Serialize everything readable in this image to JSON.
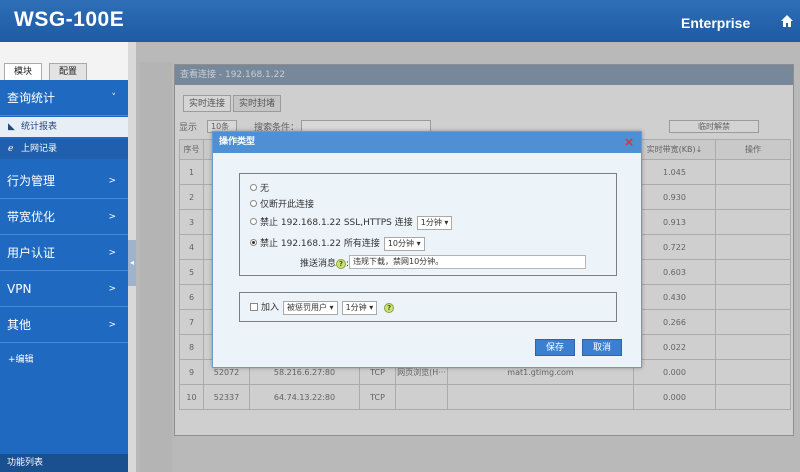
{
  "header": {
    "brand": "WSG-100E",
    "edition": "Enterprise",
    "home_icon": "home-icon"
  },
  "sidebar": {
    "tabs": [
      "模块",
      "配置"
    ],
    "menu": [
      {
        "label": "查询统计",
        "chev": "˅"
      },
      {
        "label": "行为管理",
        "chev": ">"
      },
      {
        "label": "带宽优化",
        "chev": ">"
      },
      {
        "label": "用户认证",
        "chev": ">"
      },
      {
        "label": "VPN",
        "chev": ">"
      },
      {
        "label": "其他",
        "chev": ">"
      }
    ],
    "sub_items": [
      {
        "label": "统计报表",
        "icon": "chart-icon"
      },
      {
        "label": "上网记录",
        "icon": "ie-icon"
      }
    ],
    "edit_link": "+编辑",
    "footer": "功能列表"
  },
  "bg_dialog": {
    "title": "查看连接 - 192.168.1.22",
    "tabs": [
      "实时连接",
      "实时封堵"
    ],
    "show_label": "显示",
    "page_size": "10条",
    "search_label": "搜索条件：",
    "action_button": "临时解禁",
    "columns": [
      "序号",
      "",
      "",
      "",
      "",
      "",
      "实时带宽(KB)↓",
      "操作"
    ],
    "rows": [
      {
        "no": "1",
        "port": "",
        "addr": "",
        "proto": "",
        "app": "",
        "host": "",
        "bw": "1.045"
      },
      {
        "no": "2",
        "port": "",
        "addr": "",
        "proto": "",
        "app": "",
        "host": "",
        "bw": "0.930"
      },
      {
        "no": "3",
        "port": "",
        "addr": "",
        "proto": "",
        "app": "",
        "host": "",
        "bw": "0.913"
      },
      {
        "no": "4",
        "port": "",
        "addr": "",
        "proto": "",
        "app": "",
        "host": "",
        "bw": "0.722"
      },
      {
        "no": "5",
        "port": "",
        "addr": "",
        "proto": "",
        "app": "",
        "host": "",
        "bw": "0.603"
      },
      {
        "no": "6",
        "port": "",
        "addr": "",
        "proto": "",
        "app": "",
        "host": "",
        "bw": "0.430"
      },
      {
        "no": "7",
        "port": "",
        "addr": "",
        "proto": "",
        "app": "",
        "host": "",
        "bw": "0.266"
      },
      {
        "no": "8",
        "port": "",
        "addr": "",
        "proto": "",
        "app": "",
        "host": "",
        "bw": "0.022"
      },
      {
        "no": "9",
        "port": "52072",
        "addr": "58.216.6.27:80",
        "proto": "TCP",
        "app": "网页浏览(H···",
        "host": "mat1.gtimg.com",
        "bw": "0.000"
      },
      {
        "no": "10",
        "port": "52337",
        "addr": "64.74.13.22:80",
        "proto": "TCP",
        "app": "",
        "host": "",
        "bw": "0.000"
      }
    ]
  },
  "modal": {
    "title": "操作类型",
    "close": "×",
    "option_none": "无",
    "option_disconnect": "仅断开此连接",
    "option_block_ssl": "禁止 192.168.1.22  SSL,HTTPS 连接",
    "option_block_ssl_duration": "1分钟 ▾",
    "option_block_all": "禁止 192.168.1.22 所有连接",
    "option_block_all_duration": "10分钟 ▾",
    "push_label": "推送消息",
    "push_value": "违规下载，禁网10分钟。",
    "join_label": "加入",
    "join_group": "被惩罚用户 ▾",
    "join_duration": "1分钟 ▾",
    "help": "?",
    "save": "保存",
    "cancel": "取消"
  }
}
